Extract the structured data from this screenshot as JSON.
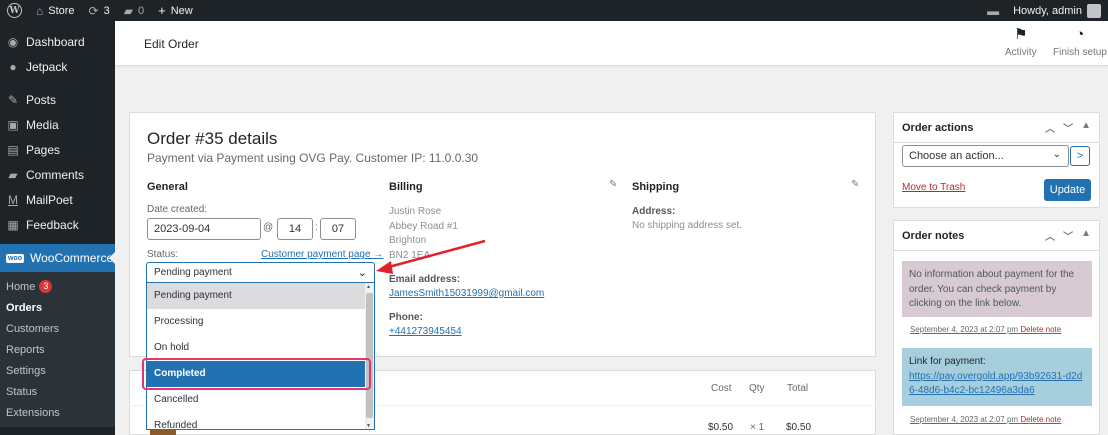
{
  "adminbar": {
    "site_name": "Store",
    "updates_count": "3",
    "comments_count": "0",
    "new_label": "New",
    "howdy": "Howdy, admin"
  },
  "sidebar": {
    "items": [
      {
        "label": "Dashboard",
        "icon": "dashboard-icon"
      },
      {
        "label": "Jetpack",
        "icon": "jetpack-icon"
      },
      {
        "label": "Posts",
        "icon": "pin-icon"
      },
      {
        "label": "Media",
        "icon": "media-icon"
      },
      {
        "label": "Pages",
        "icon": "pages-icon"
      },
      {
        "label": "Comments",
        "icon": "comments-icon"
      },
      {
        "label": "MailPoet",
        "icon": "mailpoet-icon"
      },
      {
        "label": "Feedback",
        "icon": "feedback-icon"
      }
    ],
    "woocommerce": {
      "label": "WooCommerce",
      "badge": "woo"
    },
    "submenu": [
      {
        "label": "Home",
        "count": "3"
      },
      {
        "label": "Orders"
      },
      {
        "label": "Customers"
      },
      {
        "label": "Reports"
      },
      {
        "label": "Settings"
      },
      {
        "label": "Status"
      },
      {
        "label": "Extensions"
      }
    ]
  },
  "header": {
    "title": "Edit Order",
    "activity_label": "Activity",
    "finish_setup_label": "Finish setup"
  },
  "order": {
    "title": "Order #35 details",
    "subtitle": "Payment via Payment using OVG Pay. Customer IP: 11.0.0.30",
    "general": {
      "heading": "General",
      "date_created_label": "Date created:",
      "date": "2023-09-04",
      "at": "@",
      "hour": "14",
      "colon": ":",
      "minute": "07",
      "status_label": "Status:",
      "customer_payment_link": "Customer payment page →",
      "status_value": "Pending payment",
      "status_options": [
        "Pending payment",
        "Processing",
        "On hold",
        "Completed",
        "Cancelled",
        "Refunded"
      ]
    },
    "billing": {
      "heading": "Billing",
      "address": [
        "Justin Rose",
        "Abbey Road #1",
        "Brighton",
        "BN2 1EA"
      ],
      "email_label": "Email address:",
      "email": "JamesSmith15031999@gmail.com",
      "phone_label": "Phone:",
      "phone": "+441273945454"
    },
    "shipping": {
      "heading": "Shipping",
      "address_label": "Address:",
      "address_value": "No shipping address set."
    }
  },
  "items": {
    "headers": {
      "cost": "Cost",
      "qty": "Qty",
      "total": "Total"
    },
    "row": {
      "cost": "$0.50",
      "qty": "× 1",
      "total": "$0.50"
    }
  },
  "order_actions": {
    "title": "Order actions",
    "select_placeholder": "Choose an action...",
    "go_label": ">",
    "trash_label": "Move to Trash",
    "update_label": "Update"
  },
  "order_notes": {
    "title": "Order notes",
    "notes": [
      {
        "text": "No information about payment for the order. You can check payment by clicking on the link below.",
        "date": "September 4, 2023 at 2:07 pm",
        "delete": "Delete note"
      },
      {
        "text": "Link for payment:",
        "link": "https://pay.overgold.app/93b92631-d2d6-48d6-b4c2-bc12496a3da6",
        "date": "September 4, 2023 at 2:07 pm",
        "delete": "Delete note"
      }
    ]
  },
  "colors": {
    "accent": "#2271b1",
    "sidebar_bg": "#1d2327",
    "highlight": "#e5356c",
    "arrow": "#e0202a"
  }
}
